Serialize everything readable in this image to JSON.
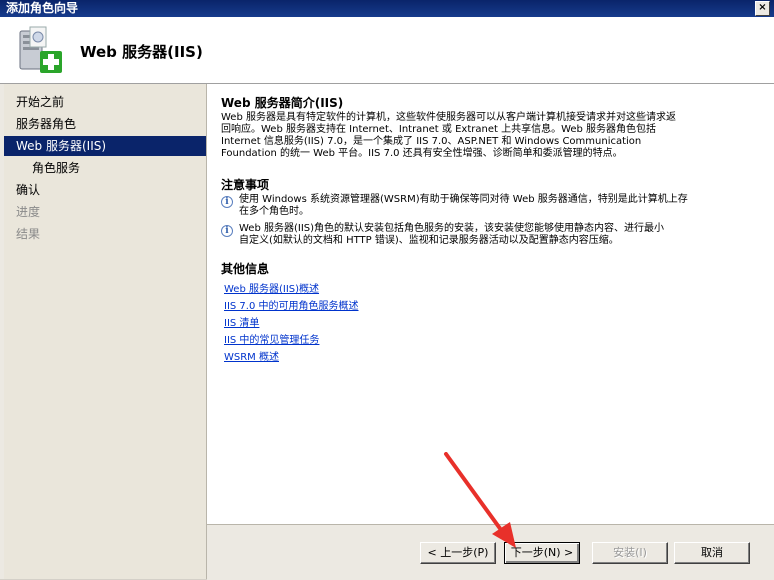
{
  "window": {
    "title": "添加角色向导",
    "close_glyph": "×"
  },
  "header": {
    "title": "Web 服务器(IIS)",
    "icon": "server-role-add-icon"
  },
  "sidebar": {
    "items": [
      {
        "label": "开始之前",
        "state": "normal"
      },
      {
        "label": "服务器角色",
        "state": "normal"
      },
      {
        "label": "Web 服务器(IIS)",
        "state": "active"
      },
      {
        "label": "角色服务",
        "state": "normal"
      },
      {
        "label": "确认",
        "state": "normal"
      },
      {
        "label": "进度",
        "state": "disabled"
      },
      {
        "label": "结果",
        "state": "disabled"
      }
    ]
  },
  "content": {
    "intro_title": "Web 服务器简介(IIS)",
    "intro_lines": [
      "Web 服务器是具有特定软件的计算机，这些软件使服务器可以从客户端计算机接受请求并对这些请求返",
      "回响应。Web 服务器支持在 Internet、Intranet 或 Extranet 上共享信息。Web 服务器角色包括",
      "Internet 信息服务(IIS) 7.0，是一个集成了 IIS 7.0、ASP.NET 和 Windows Communication",
      "Foundation 的统一 Web 平台。IIS 7.0 还具有安全性增强、诊断简单和委派管理的特点。"
    ],
    "notes_title": "注意事项",
    "notes": [
      {
        "icon": "info-icon",
        "lines": [
          "使用 Windows 系统资源管理器(WSRM)有助于确保等同对待 Web 服务器通信，特别是此计算机上存",
          "在多个角色时。"
        ]
      },
      {
        "icon": "info-icon",
        "lines": [
          "Web 服务器(IIS)角色的默认安装包括角色服务的安装，该安装使您能够使用静态内容、进行最小",
          "自定义(如默认的文档和 HTTP 错误)、监视和记录服务器活动以及配置静态内容压缩。"
        ]
      }
    ],
    "more_title": "其他信息",
    "links": [
      "Web 服务器(IIS)概述",
      "IIS 7.0 中的可用角色服务概述",
      "IIS 清单",
      "IIS 中的常见管理任务",
      "WSRM 概述"
    ]
  },
  "footer": {
    "prev_label": "< 上一步(P)",
    "next_label": "下一步(N) >",
    "install_label": "安装(I)",
    "cancel_label": "取消"
  },
  "colors": {
    "selection": "#0a246a",
    "link": "#0033cc",
    "annotation_arrow": "#e8302a"
  }
}
